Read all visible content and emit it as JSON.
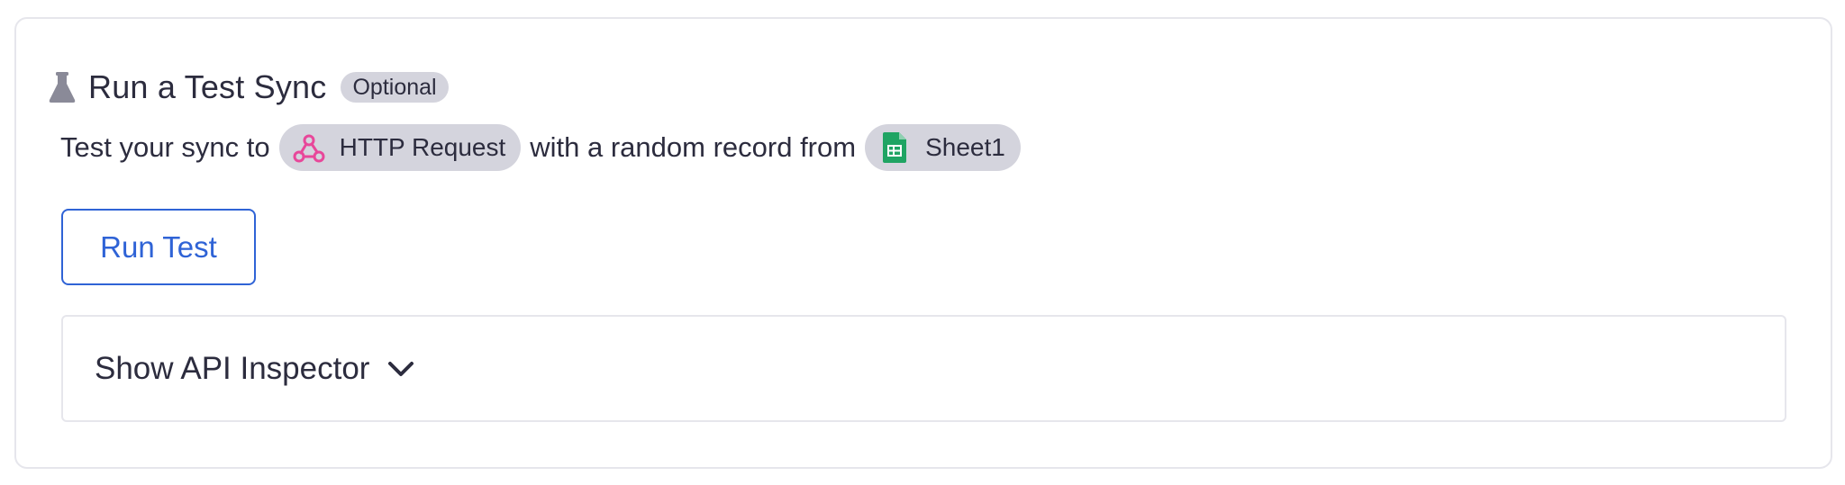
{
  "section": {
    "title": "Run a Test Sync",
    "badge": "Optional",
    "icon": "flask-icon"
  },
  "description": {
    "prefix": "Test your sync to",
    "destination": {
      "label": "HTTP Request",
      "icon": "webhook-icon",
      "color": "#e8479a"
    },
    "middle": "with a random record from",
    "source": {
      "label": "Sheet1",
      "icon": "google-sheets-icon",
      "color": "#1fa463"
    }
  },
  "run_button": {
    "label": "Run Test",
    "color": "#2f63d6"
  },
  "api_inspector": {
    "label": "Show API Inspector",
    "icon": "chevron-down-icon"
  }
}
